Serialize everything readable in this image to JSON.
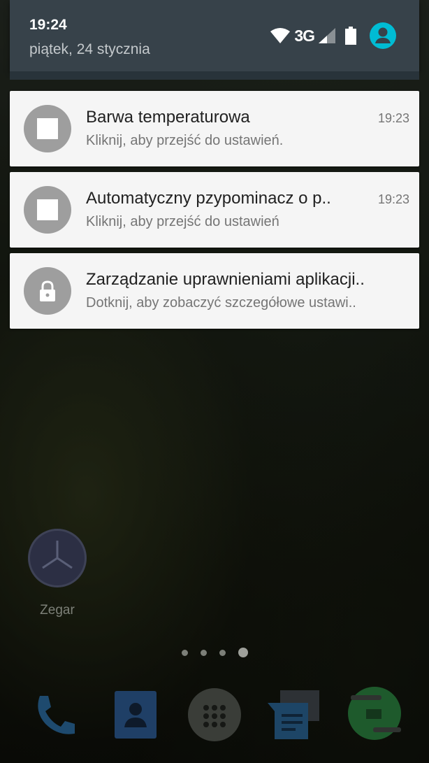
{
  "status_bar": {
    "time": "19:24",
    "date": "piątek, 24 stycznia",
    "network_type": "3G",
    "icons": [
      "wifi-icon",
      "cell-signal-icon",
      "battery-icon",
      "user-account-icon"
    ],
    "accent_color": "#00bcd4",
    "header_color": "#37424a"
  },
  "notifications": [
    {
      "icon": "stop-square-icon",
      "title": "Barwa temperaturowa",
      "text": "Kliknij, aby przejść do ustawień.",
      "time": "19:23"
    },
    {
      "icon": "stop-square-icon",
      "title": "Automatyczny pzypominacz o p..",
      "text": "Kliknij, aby przejść do ustawień",
      "time": "19:23"
    },
    {
      "icon": "lock-icon",
      "title": "Zarządzanie uprawnieniami aplikacji..",
      "text": "Dotknij, aby zobaczyć szczegółowe ustawi..",
      "time": ""
    }
  ],
  "home": {
    "clock_app_label": "Zegar",
    "page_indicator": {
      "pages": 4,
      "current": 4
    },
    "dock": [
      "phone-icon",
      "contacts-icon",
      "app-drawer-icon",
      "messaging-icon",
      "hangouts-icon"
    ]
  }
}
